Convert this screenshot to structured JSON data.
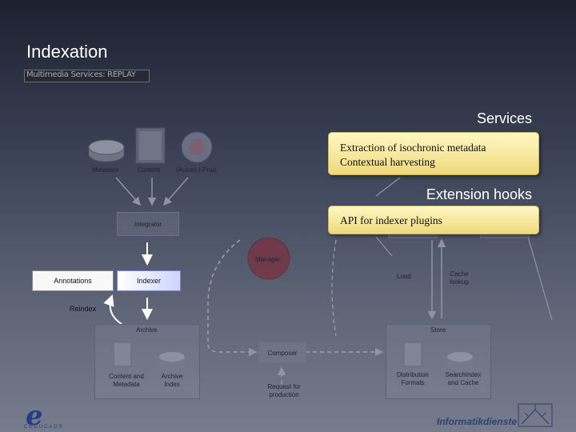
{
  "title": "Indexation",
  "subtitle": "Multimedia Services: REPLAY",
  "headings": {
    "services": "Services",
    "extension_hooks": "Extension hooks"
  },
  "notes": {
    "services_line1": "Extraction of isochronic metadata",
    "services_line2": "Contextual harvesting",
    "hooks": "API for indexer plugins"
  },
  "diagram": {
    "metadata": "Metadata",
    "content": "Content",
    "autom_prod": "(Autom.) Prod.",
    "integrator": "Integrator",
    "manager": "Manager",
    "annotations": "Annotations",
    "indexer": "Indexer",
    "reindex": "Reindex",
    "archive": "Archive",
    "content_and_metadata": "Content and Metadata",
    "archive_index": "Archive Index",
    "composer": "Composer",
    "request_for_production": "Request for production",
    "load": "Load",
    "cache_lookup": "Cache lookup",
    "store": "Store",
    "distribution_formats": "Distribution Formats",
    "searchindex_and_cache": "SearchIndex and Cache"
  },
  "footer": {
    "logo_letter": "e",
    "logo_text": "CEDUCADS",
    "informatikdienste": "Informatikdienste"
  },
  "colors": {
    "note_fill": "#f6e69a",
    "indexer_gradient_end": "#cbd5ff",
    "manager_circle": "#7a3040"
  }
}
